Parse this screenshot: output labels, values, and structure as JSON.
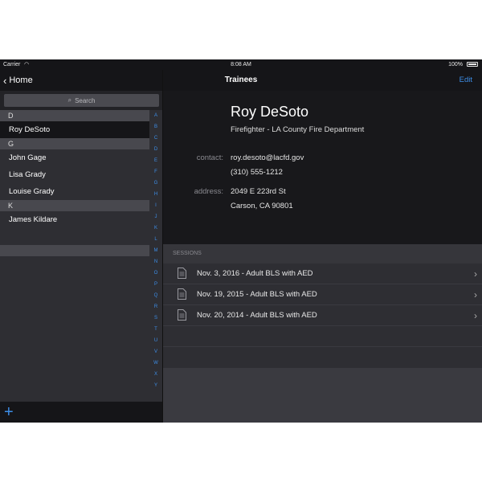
{
  "status": {
    "carrier": "Carrier",
    "time": "8:08 AM",
    "battery": "100%"
  },
  "master": {
    "back_label": "Home",
    "search_placeholder": "Search",
    "sections": [
      {
        "header": "D",
        "rows": [
          "Roy DeSoto"
        ]
      },
      {
        "header": "G",
        "rows": [
          "John Gage",
          "Lisa Grady",
          "Louise Grady"
        ]
      },
      {
        "header": "K",
        "rows": [
          "James Kildare"
        ]
      }
    ],
    "selected": "Roy DeSoto",
    "index": [
      "A",
      "B",
      "C",
      "D",
      "E",
      "F",
      "G",
      "H",
      "I",
      "J",
      "K",
      "L",
      "M",
      "N",
      "O",
      "P",
      "Q",
      "R",
      "S",
      "T",
      "U",
      "V",
      "W",
      "X",
      "Y"
    ]
  },
  "detail": {
    "title": "Trainees",
    "edit_label": "Edit",
    "name": "Roy DeSoto",
    "subtitle": "Firefighter - LA County Fire Department",
    "contact_label": "contact:",
    "email": "roy.desoto@lacfd.gov",
    "phone": "(310) 555-1212",
    "address_label": "address:",
    "address_line1": "2049 E 223rd St",
    "address_line2": "Carson, CA 90801",
    "sessions_header": "SESSIONS",
    "sessions": [
      "Nov. 3, 2016 - Adult BLS with AED",
      "Nov. 19, 2015 - Adult BLS with AED",
      "Nov. 20, 2014 - Adult BLS with AED"
    ]
  },
  "colors": {
    "accent": "#3d8ee8",
    "nav_bg": "#151518",
    "panel_bg": "#2e2e33"
  }
}
